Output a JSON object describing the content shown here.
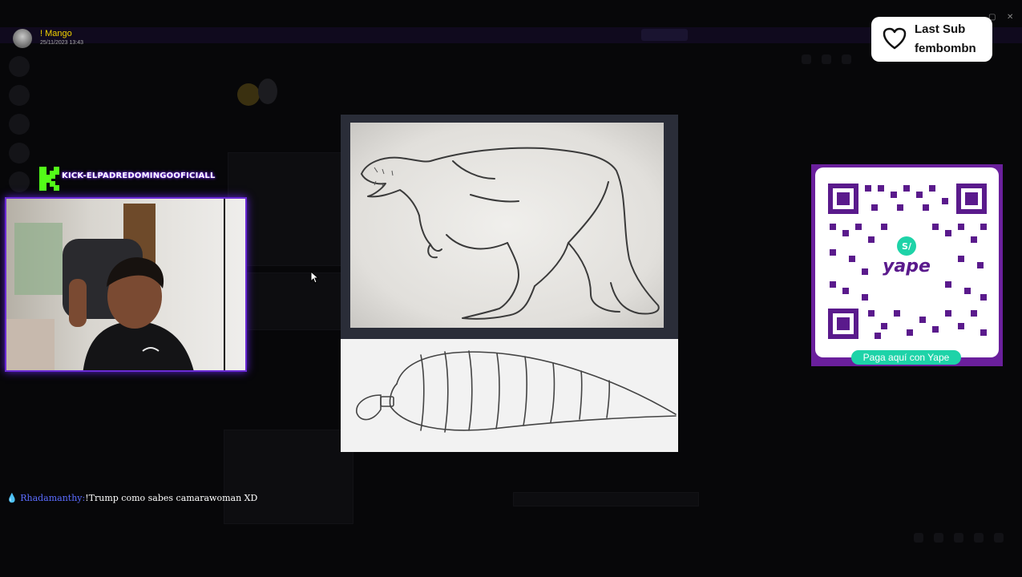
{
  "notification": {
    "name": "! Mango",
    "date": "25/11/2023 13:43"
  },
  "kick": {
    "handle": "KICK-ELPADREDOMINGOOFICIALL"
  },
  "last_sub": {
    "label": "Last Sub",
    "username": "fembombn"
  },
  "qr": {
    "button_label": "Paga aquí con Yape",
    "brand": "yape"
  },
  "chat": {
    "username": "Rhadamanthy:",
    "message": "!Trump como sabes camarawoman XD"
  },
  "colors": {
    "accent_purple": "#6a2bd6",
    "yape_teal": "#1ed3a8",
    "yape_purple": "#6a1f9c",
    "kick_green": "#53fc18"
  }
}
